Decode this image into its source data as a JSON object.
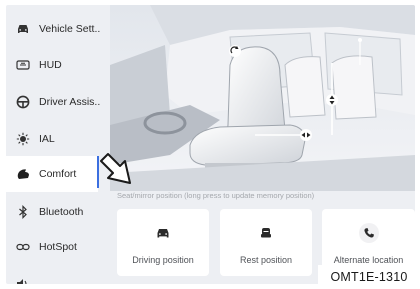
{
  "sidebar": {
    "items": [
      {
        "label": "Vehicle Sett..",
        "icon": "car-icon"
      },
      {
        "label": "HUD",
        "icon": "hud-icon"
      },
      {
        "label": "Driver Assis..",
        "icon": "steering-wheel-icon"
      },
      {
        "label": "IAL",
        "icon": "light-icon"
      },
      {
        "label": "Comfort",
        "icon": "seat-icon"
      },
      {
        "label": "Bluetooth",
        "icon": "bluetooth-icon"
      },
      {
        "label": "HotSpot",
        "icon": "hotspot-icon"
      }
    ],
    "active_index": 4
  },
  "content": {
    "caption": "Seat/mirror position (long press to update memory position)",
    "cards": [
      {
        "label": "Driving position",
        "icon": "car-front-icon"
      },
      {
        "label": "Rest position",
        "icon": "seat-rest-icon"
      },
      {
        "label": "Alternate location",
        "icon": "phone-icon"
      }
    ]
  },
  "figure_code": "OMT1E-1310",
  "colors": {
    "accent": "#3b6fe0",
    "panel_bg": "#edeff3",
    "active_bg": "#ffffff"
  }
}
